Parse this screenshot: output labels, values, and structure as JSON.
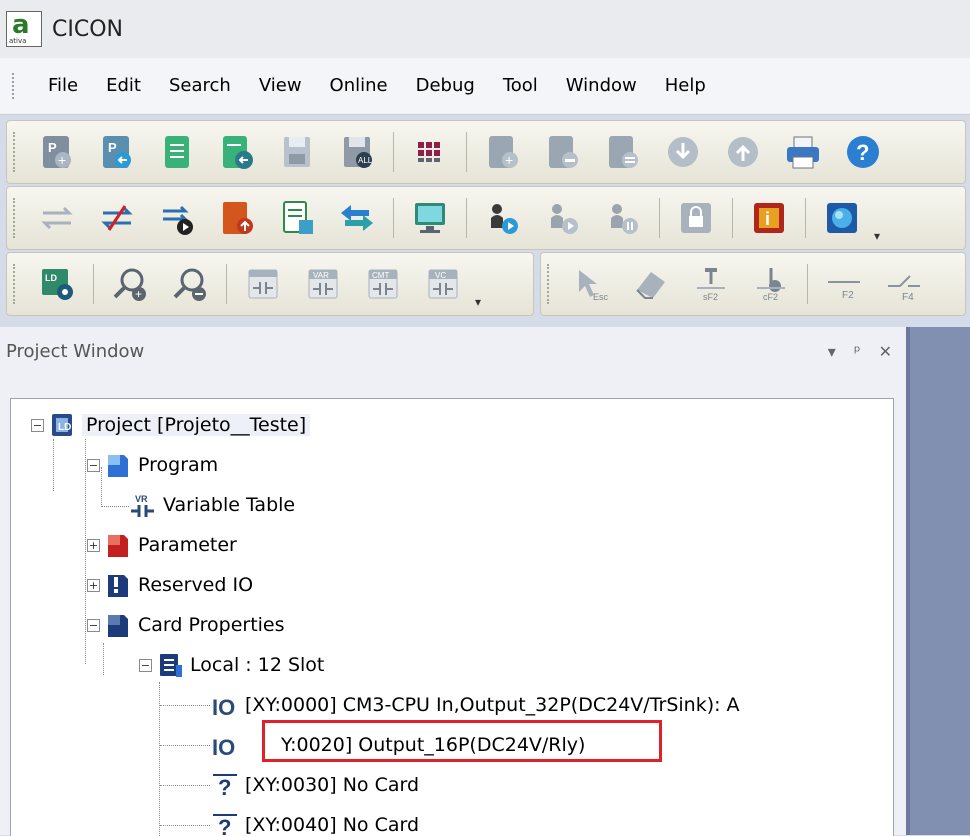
{
  "window": {
    "title": "CICON",
    "logo_letter": "a",
    "logo_subtext": "ativa"
  },
  "menu": [
    "File",
    "Edit",
    "Search",
    "View",
    "Online",
    "Debug",
    "Tool",
    "Window",
    "Help"
  ],
  "toolbar1": [
    "new-project-icon",
    "open-project-icon",
    "close-project-icon",
    "import-icon",
    "save-icon",
    "save-all-icon",
    "grid-icon",
    "add-program-icon",
    "delete-program-icon",
    "program-list-icon",
    "download-icon",
    "upload-icon",
    "print-icon",
    "help-icon"
  ],
  "toolbar2": [
    "connect-icon",
    "disconnect-icon",
    "run-icon",
    "write-plc-icon",
    "clear-icon",
    "compare-icon",
    "monitor-icon",
    "run-mode-icon",
    "stop-mode-icon",
    "pause-mode-icon",
    "lock-icon",
    "info-icon",
    "network-icon"
  ],
  "toolbar3": [
    "ld-settings-icon",
    "zoom-in-icon",
    "zoom-out-icon",
    "ladder-contact-icon",
    "var-view-icon",
    "comment-view-icon",
    "variable-comment-icon"
  ],
  "toolbar4": [
    "esc-icon",
    "eraser-icon",
    "contact-sf2-icon",
    "contact-cf2-icon",
    "line-f2-icon",
    "line-f4-icon"
  ],
  "project_window": {
    "title": "Project Window",
    "tree": {
      "root": "Project [Projeto__Teste]",
      "program": "Program",
      "variable_table": "Variable Table",
      "parameter": "Parameter",
      "reserved_io": "Reserved IO",
      "card_properties": "Card Properties",
      "local": "Local : 12 Slot",
      "slots": [
        "[XY:0000] CM3-CPU In,Output_32P(DC24V/TrSink): A",
        "Y:0020] Output_16P(DC24V/Rly)",
        "[XY:0030] No Card",
        "[XY:0040] No Card"
      ]
    }
  },
  "colors": {
    "highlight": "#e0202a",
    "program_icon": "#2f6fd6",
    "parameter_icon": "#c42020",
    "card_icon": "#1d3a7a"
  }
}
